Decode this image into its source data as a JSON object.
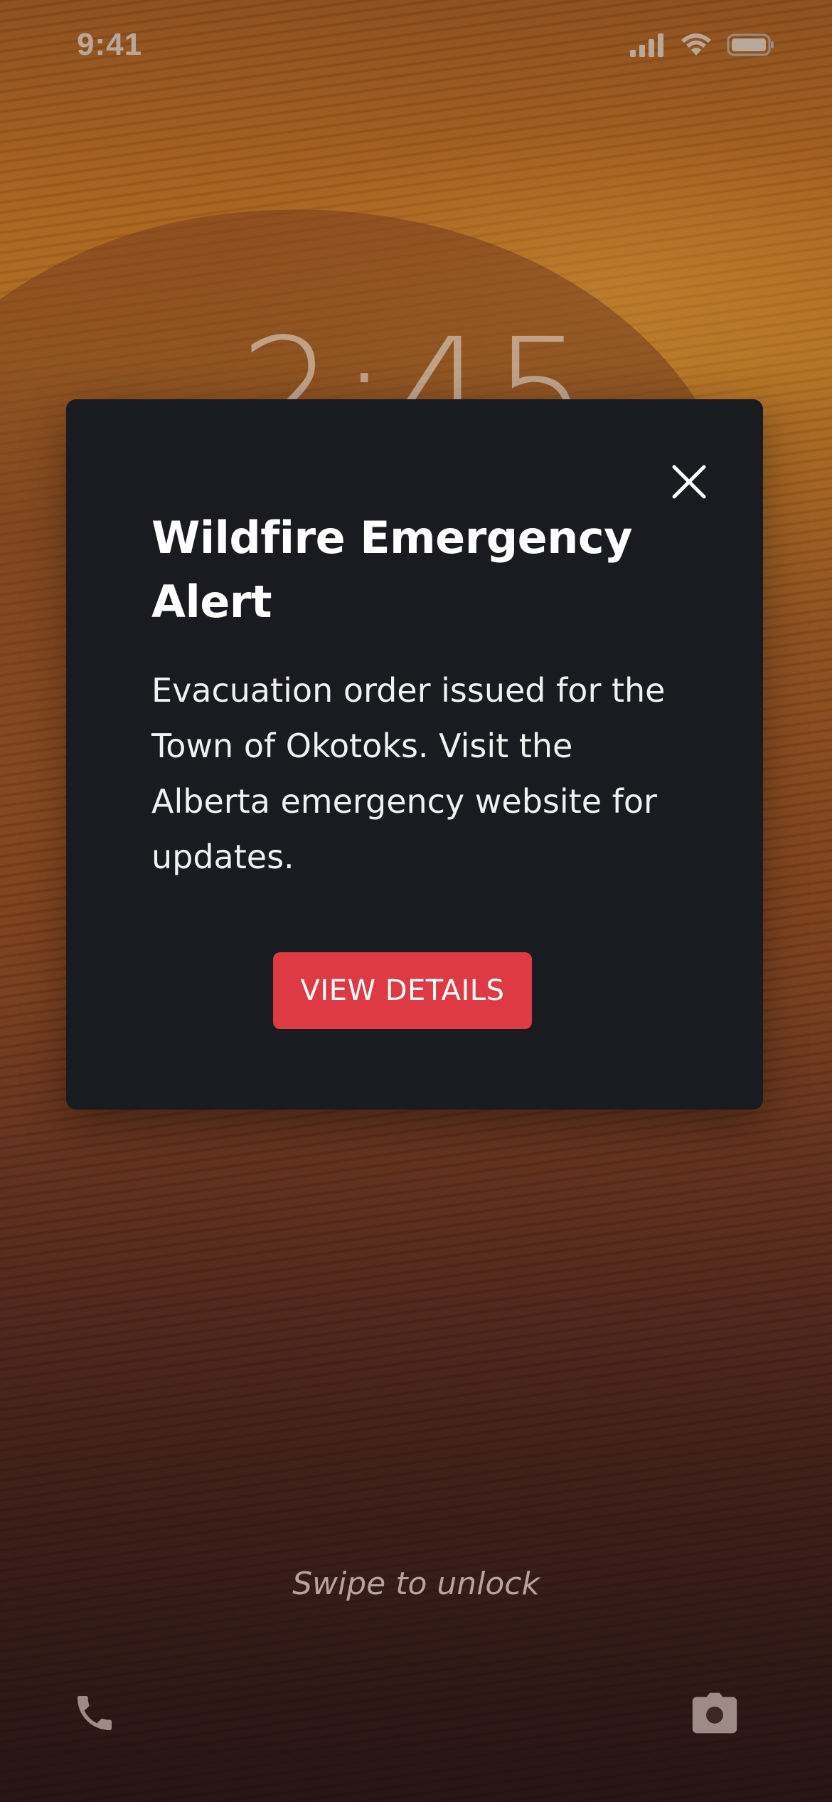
{
  "status_bar": {
    "time": "9:41",
    "icons": [
      "signal-icon",
      "wifi-icon",
      "battery-icon"
    ]
  },
  "lock_screen": {
    "clock": "2:45",
    "swipe_hint": "Swipe to unlock",
    "quick_actions": [
      "phone-icon",
      "camera-icon"
    ]
  },
  "alert": {
    "title": "Wildfire Emergency Alert",
    "body": "Evacuation order issued for the Town of Okotoks. Visit the Alberta emergency website for updates.",
    "button_label": "VIEW DETAILS",
    "close_icon": "close-icon"
  },
  "colors": {
    "card_background": "#191b20",
    "button_accent": "#de3a44",
    "text_primary": "#ffffff"
  }
}
